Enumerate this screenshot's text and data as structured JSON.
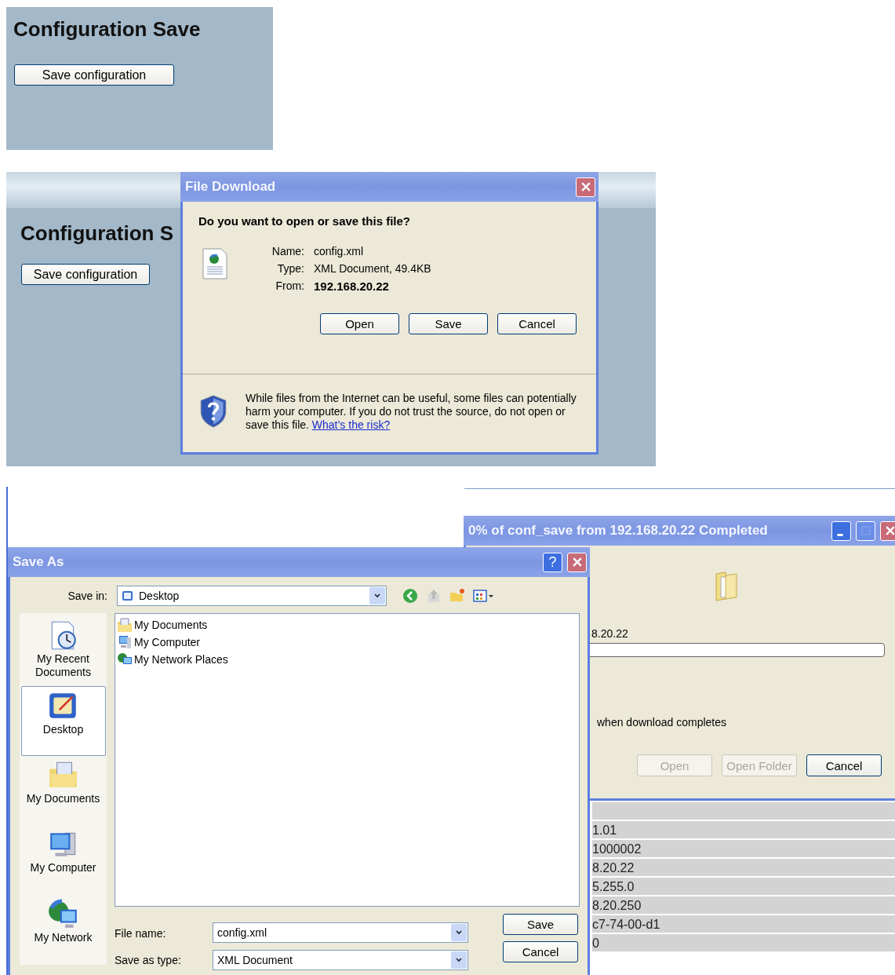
{
  "config_panel": {
    "title": "Configuration Save",
    "button": "Save configuration"
  },
  "download_page": {
    "title": "Configuration S",
    "button": "Save configuration"
  },
  "file_download": {
    "title": "File Download",
    "question": "Do you want to open or save this file?",
    "fields": [
      {
        "label": "Name:",
        "value": "config.xml",
        "bold": false
      },
      {
        "label": "Type:",
        "value": "XML Document, 49.4KB",
        "bold": false
      },
      {
        "label": "From:",
        "value": "192.168.20.22",
        "bold": true
      }
    ],
    "buttons": [
      "Open",
      "Save",
      "Cancel"
    ],
    "warning": "While files from the Internet can be useful, some files can potentially harm your computer. If you do not trust the source, do not open or save this file.",
    "link": "What’s the risk?"
  },
  "progress": {
    "title": "0% of conf_save from 192.168.20.22 Completed",
    "source": "8.20.22",
    "level": 0,
    "option": "when download completes",
    "buttons": [
      {
        "label": "Open",
        "disabled": true
      },
      {
        "label": "Open Folder",
        "disabled": true
      },
      {
        "label": "Cancel",
        "disabled": false
      }
    ]
  },
  "save_as": {
    "title": "Save As",
    "help_button": "?",
    "save_in_label": "Save in:",
    "save_in": "Desktop",
    "places": [
      {
        "label": "My Recent Documents",
        "kind": "recent",
        "selected": false
      },
      {
        "label": "Desktop",
        "kind": "desktop",
        "selected": true
      },
      {
        "label": "My Documents",
        "kind": "documents",
        "selected": false
      },
      {
        "label": "My Computer",
        "kind": "computer",
        "selected": false
      },
      {
        "label": "My Network",
        "kind": "network",
        "selected": false
      }
    ],
    "files": [
      {
        "name": "My Documents",
        "kind": "documents"
      },
      {
        "name": "My Computer",
        "kind": "computer"
      },
      {
        "name": "My Network Places",
        "kind": "network"
      }
    ],
    "file_name_label": "File name:",
    "file_name": "config.xml",
    "type_label": "Save as type:",
    "type": "XML Document",
    "buttons": [
      "Save",
      "Cancel"
    ]
  },
  "table": {
    "rows": [
      "1.01",
      "1000002",
      "8.20.22",
      "5.255.0",
      "8.20.250",
      "c7-74-00-d1",
      "0"
    ]
  }
}
